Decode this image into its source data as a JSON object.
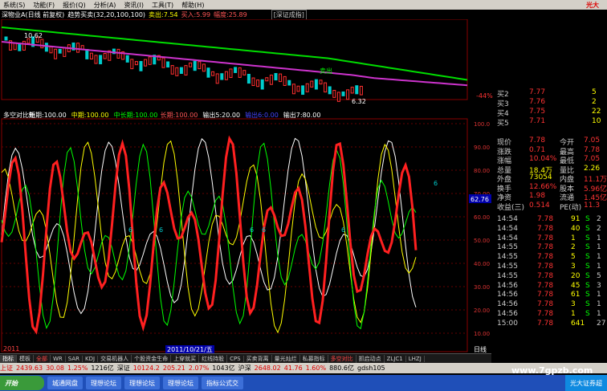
{
  "menu": {
    "items": [
      "系统(S)",
      "功能(F)",
      "报价(Q)",
      "分析(A)",
      "资讯(I)",
      "工具(T)",
      "帮助(H)"
    ],
    "brand": "光大"
  },
  "title": {
    "stock": "深物业A(日线 前复权)",
    "indicator": "趋势买卖(32,20,100,100)",
    "sell_label": "卖出:7.54",
    "buy_label": "买入:5.99",
    "amp_label": "幅度:25.89",
    "tag": "[深证成指]"
  },
  "main_chart": {
    "price_label": "10.62",
    "low_label": "6.32",
    "sell_marker": "卖出",
    "pct_label": "-44%"
  },
  "sub_chart": {
    "header": [
      "多空对比新",
      "短期:100.00",
      "中期:100.00",
      "中长期:100.00",
      "长期:100.00",
      "输出5:20.00",
      "输出6:0.00",
      "输出7:80.00"
    ],
    "y_labels": [
      "100.0",
      "90.00",
      "80.00",
      "70.00",
      "60.00",
      "50.00",
      "40.00",
      "30.00",
      "20.00",
      "10.00"
    ],
    "hl_value": "62.76",
    "marker_text": "6"
  },
  "date_label": "2011/10/21/五",
  "axis": {
    "left": "2011",
    "right": "日线"
  },
  "order_book": [
    {
      "label": "买2",
      "price": "7.77",
      "vol": "5"
    },
    {
      "label": "买3",
      "price": "7.76",
      "vol": "2"
    },
    {
      "label": "买4",
      "price": "7.75",
      "vol": "22"
    },
    {
      "label": "买5",
      "price": "7.71",
      "vol": "10"
    }
  ],
  "stats": [
    {
      "l1": "现价",
      "v1": "7.78",
      "l2": "今开",
      "v2": "7.05"
    },
    {
      "l1": "涨跌",
      "v1": "0.71",
      "l2": "最高",
      "v2": "7.78"
    },
    {
      "l1": "涨幅",
      "v1": "10.04%",
      "l2": "最低",
      "v2": "7.05"
    },
    {
      "l1": "总量",
      "v1": "18.4万",
      "l2": "量比",
      "v2": "2.26"
    },
    {
      "l1": "外盘",
      "v1": "73054",
      "l2": "内盘",
      "v2": "11.1万"
    },
    {
      "l1": "换手",
      "v1": "12.66%",
      "l2": "股本",
      "v2": "5.96亿"
    },
    {
      "l1": "净资",
      "v1": "1.98",
      "l2": "流通",
      "v2": "1.45亿"
    },
    {
      "l1": "收益(三)",
      "v1": "0.514",
      "l2": "PE(动)",
      "v2": "11.3"
    }
  ],
  "ticks": [
    {
      "t": "14:54",
      "p": "7.78",
      "v": "91",
      "s": "S",
      "n": "2"
    },
    {
      "t": "14:54",
      "p": "7.78",
      "v": "40",
      "s": "S",
      "n": "2"
    },
    {
      "t": "14:54",
      "p": "7.78",
      "v": "1",
      "s": "S",
      "n": "1"
    },
    {
      "t": "14:55",
      "p": "7.78",
      "v": "2",
      "s": "S",
      "n": "1"
    },
    {
      "t": "14:55",
      "p": "7.78",
      "v": "5",
      "s": "S",
      "n": "1"
    },
    {
      "t": "14:55",
      "p": "7.78",
      "v": "3",
      "s": "S",
      "n": "1"
    },
    {
      "t": "14:55",
      "p": "7.78",
      "v": "20",
      "s": "S",
      "n": "5"
    },
    {
      "t": "14:56",
      "p": "7.78",
      "v": "45",
      "s": "S",
      "n": "3"
    },
    {
      "t": "14:56",
      "p": "7.78",
      "v": "61",
      "s": "S",
      "n": "1"
    },
    {
      "t": "14:56",
      "p": "7.78",
      "v": "3",
      "s": "S",
      "n": "1"
    },
    {
      "t": "14:56",
      "p": "7.78",
      "v": "1",
      "s": "S",
      "n": "1"
    },
    {
      "t": "15:00",
      "p": "7.78",
      "v": "641",
      "s": "",
      "n": "27"
    }
  ],
  "tabs": [
    "指标",
    "模板",
    "全部",
    "WR",
    "SAR",
    "KDJ",
    "交易机器人",
    "个股资金生命",
    "上穿就买",
    "红线持股",
    "CPS",
    "买卖背离",
    "量光灿烂",
    "私募指标",
    "多空对比",
    "抓启动点",
    "ZLJC1",
    "LHZJ"
  ],
  "status": {
    "sh_label": "上证",
    "sh_index": "2439.63",
    "sh_chg": "30.08",
    "sh_pct": "1.25%",
    "sh_amt": "1216亿",
    "sz_label": "深证",
    "sz_index": "10124.2",
    "sz_chg": "205.21",
    "sz_pct": "2.07%",
    "sz_amt": "1043亿",
    "hs_label": "沪深",
    "hs_index": "2648.02",
    "hs_chg": "41.76",
    "hs_pct": "1.60%",
    "hs_amt": "880.6亿",
    "code": "gdsh105"
  },
  "taskbar": {
    "start": "开始",
    "items": [
      "城通网盘",
      "理想论坛",
      "理想论坛",
      "理想论坛",
      "指标公式交"
    ],
    "tray": "光大证券超"
  },
  "watermark": "www.7gpzb.com",
  "colors": {
    "red": "#ff2020",
    "green": "#00dd00",
    "yellow": "#ffff00",
    "white": "#ffffff",
    "magenta": "#cc33cc",
    "cyan": "#00cccc"
  }
}
